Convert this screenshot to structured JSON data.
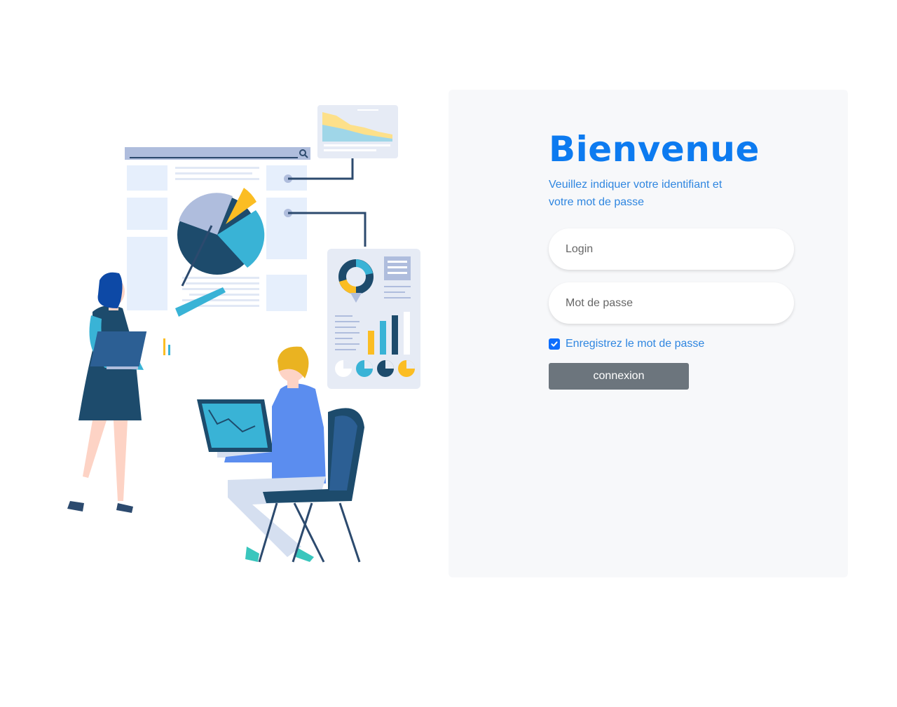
{
  "welcome": {
    "title": "Bienvenue",
    "subtitle": "Veuillez indiquer votre identifiant et votre mot de passe"
  },
  "form": {
    "login_placeholder": "Login",
    "password_placeholder": "Mot de passe",
    "remember_label": "Enregistrez le mot de passe",
    "remember_checked": true,
    "submit_label": "connexion"
  },
  "colors": {
    "accent": "#0d7bf0",
    "panel_bg": "#f7f8fa",
    "button_bg": "#6c757d",
    "checkbox": "#0d6efd"
  },
  "illustration": {
    "icon": "data-analytics-illustration"
  }
}
